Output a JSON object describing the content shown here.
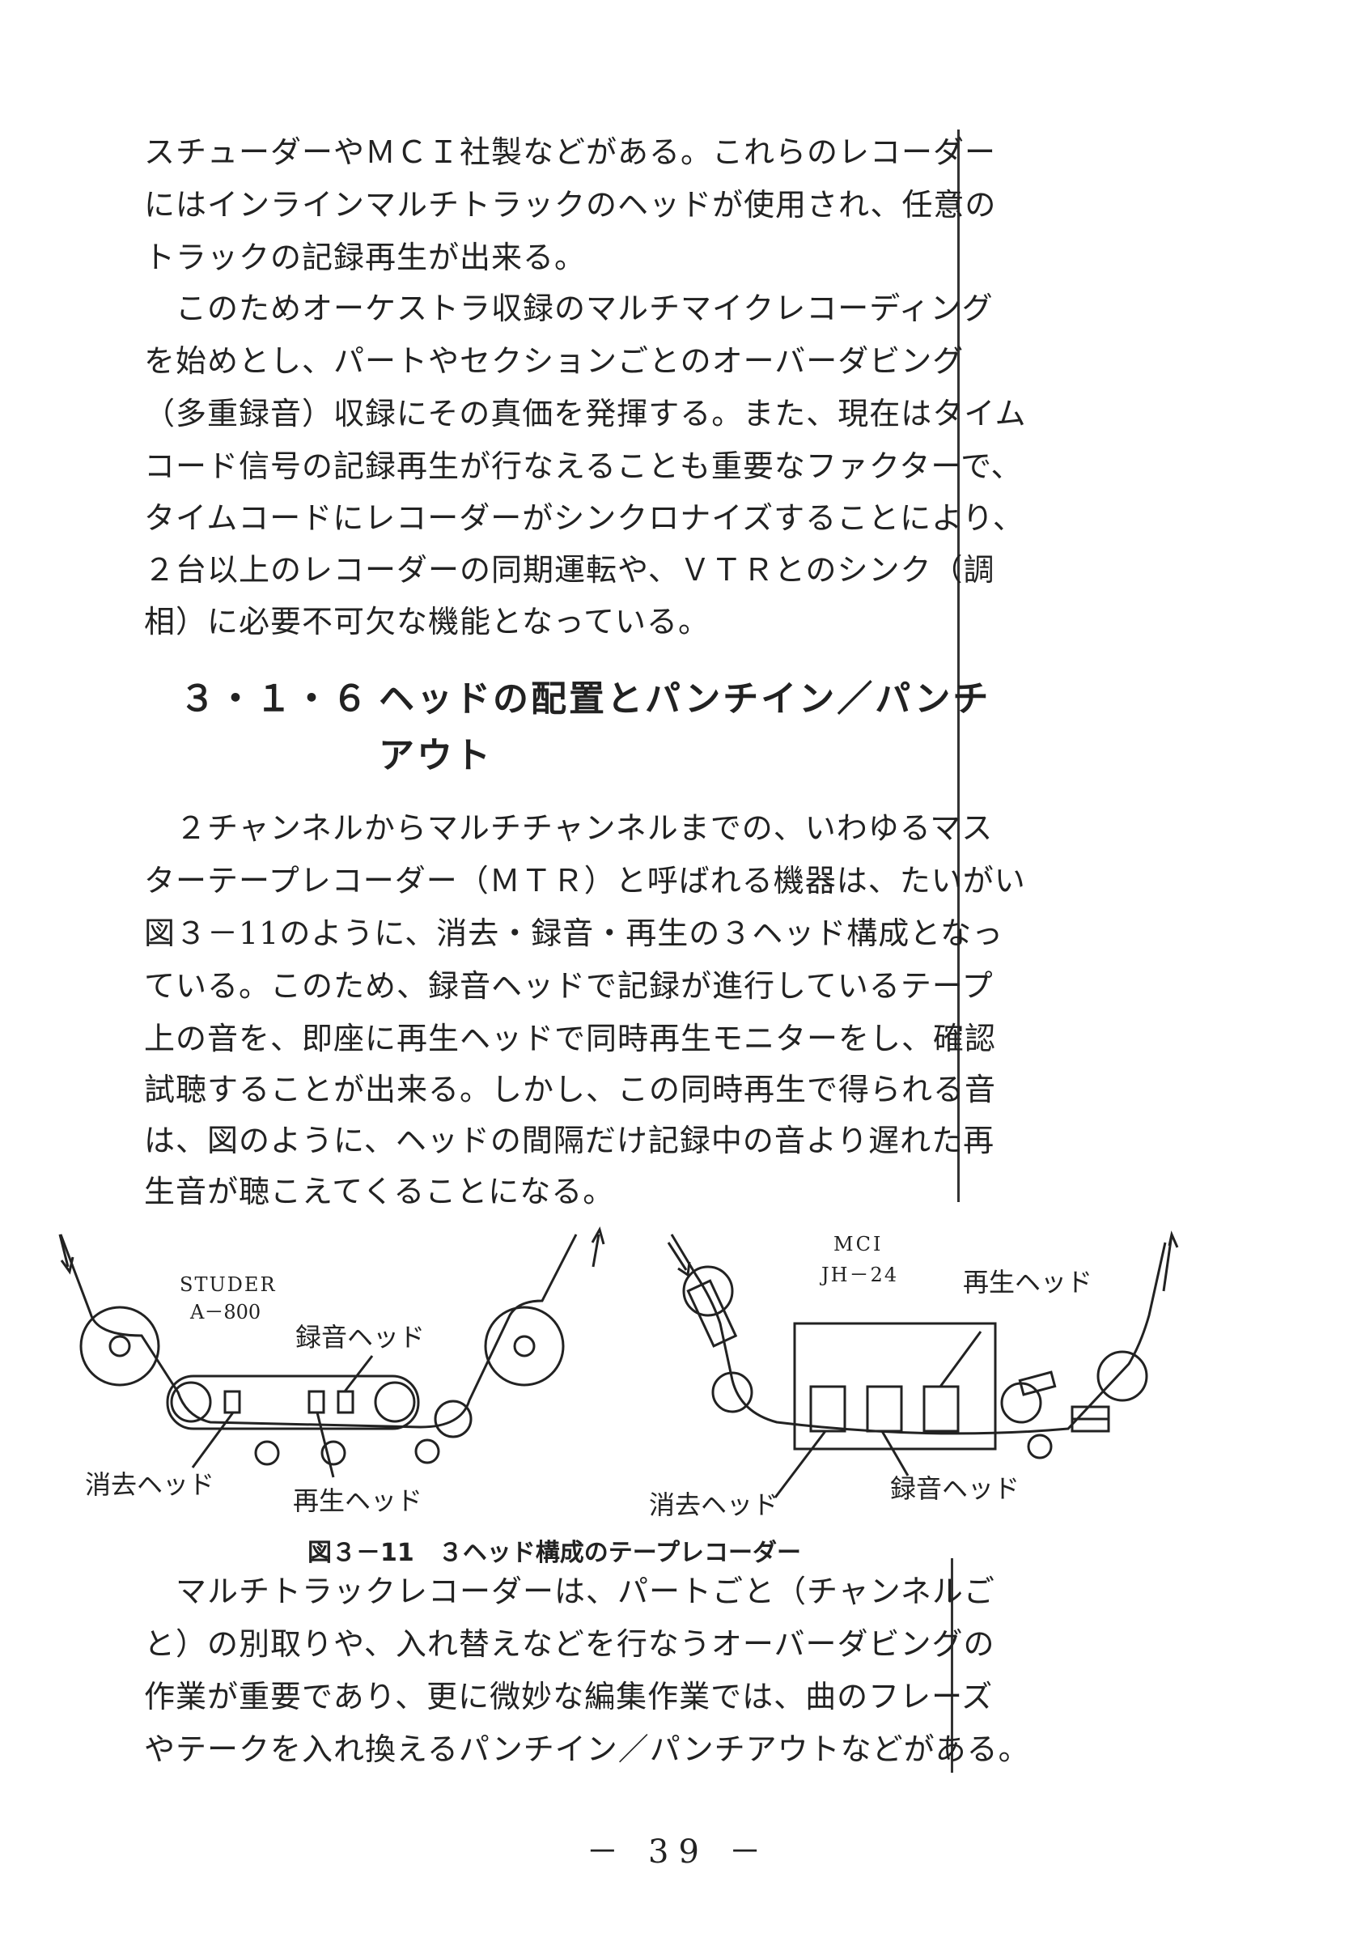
{
  "paragraphs": {
    "p1": [
      "スチューダーやＭＣＩ社製などがある。これらのレコーダー",
      "にはインラインマルチトラックのヘッドが使用され、任意の",
      "トラックの記録再生が出来る。"
    ],
    "p2": [
      "　このためオーケストラ収録のマルチマイクレコーディング",
      "を始めとし、パートやセクションごとのオーバーダビング",
      "（多重録音）収録にその真価を発揮する。また、現在はタイム",
      "コード信号の記録再生が行なえることも重要なファクターで、",
      "タイムコードにレコーダーがシンクロナイズすることにより、",
      "２台以上のレコーダーの同期運転や、ＶＴＲとのシンク（調",
      "相）に必要不可欠な機能となっている。"
    ],
    "p3": [
      "　２チャンネルからマルチチャンネルまでの、いわゆるマス",
      "ターテープレコーダー（ＭＴＲ）と呼ばれる機器は、たいがい",
      "図３－11のように、消去・録音・再生の３ヘッド構成となっ",
      "ている。このため、録音ヘッドで記録が進行しているテープ",
      "上の音を、即座に再生ヘッドで同時再生モニターをし、確認",
      "試聴することが出来る。しかし、この同時再生で得られる音",
      "は、図のように、ヘッドの間隔だけ記録中の音より遅れた再",
      "生音が聴こえてくることになる。"
    ],
    "p4": [
      "　マルチトラックレコーダーは、パートごと（チャンネルご",
      "と）の別取りや、入れ替えなどを行なうオーバーダビングの",
      "作業が重要であり、更に微妙な編集作業では、曲のフレーズ",
      "やテークを入れ換えるパンチイン／パンチアウトなどがある。"
    ]
  },
  "heading": {
    "number": "３・１・６",
    "line1": "ヘッドの配置とパンチイン／パンチ",
    "line2": "アウト"
  },
  "figure": {
    "left": {
      "model_line1": "STUDER",
      "model_line2": "A－800",
      "record_head": "録音ヘッド",
      "erase_head": "消去ヘッド",
      "play_head": "再生ヘッド"
    },
    "right": {
      "model_line1": "MCI",
      "model_line2": "JH－24",
      "play_head": "再生ヘッド",
      "erase_head": "消去ヘッド",
      "record_head": "録音ヘッド"
    },
    "caption": "図３－11　３ヘッド構成のテープレコーダー"
  },
  "page_number": "－ 39 －"
}
